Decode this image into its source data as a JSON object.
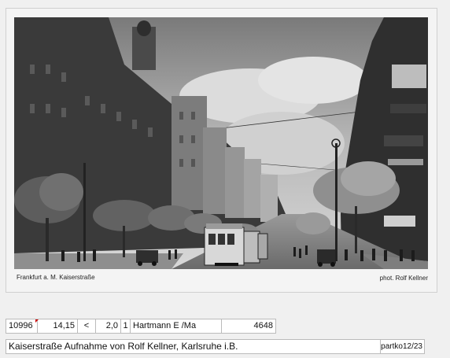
{
  "postcard": {
    "caption_left": "Frankfurt a. M. Kaiserstraße",
    "caption_right": "phot. Rolf Kellner"
  },
  "record": {
    "id": "10996",
    "value1": "14,15",
    "operator": "<",
    "value2": "2,0",
    "count": "1",
    "dealer": "Hartmann E /Ma",
    "number": "4648"
  },
  "description": {
    "text": "Kaiserstraße  Aufnahme von Rolf Kellner, Karlsruhe i.B.",
    "code": "partko12/23"
  }
}
